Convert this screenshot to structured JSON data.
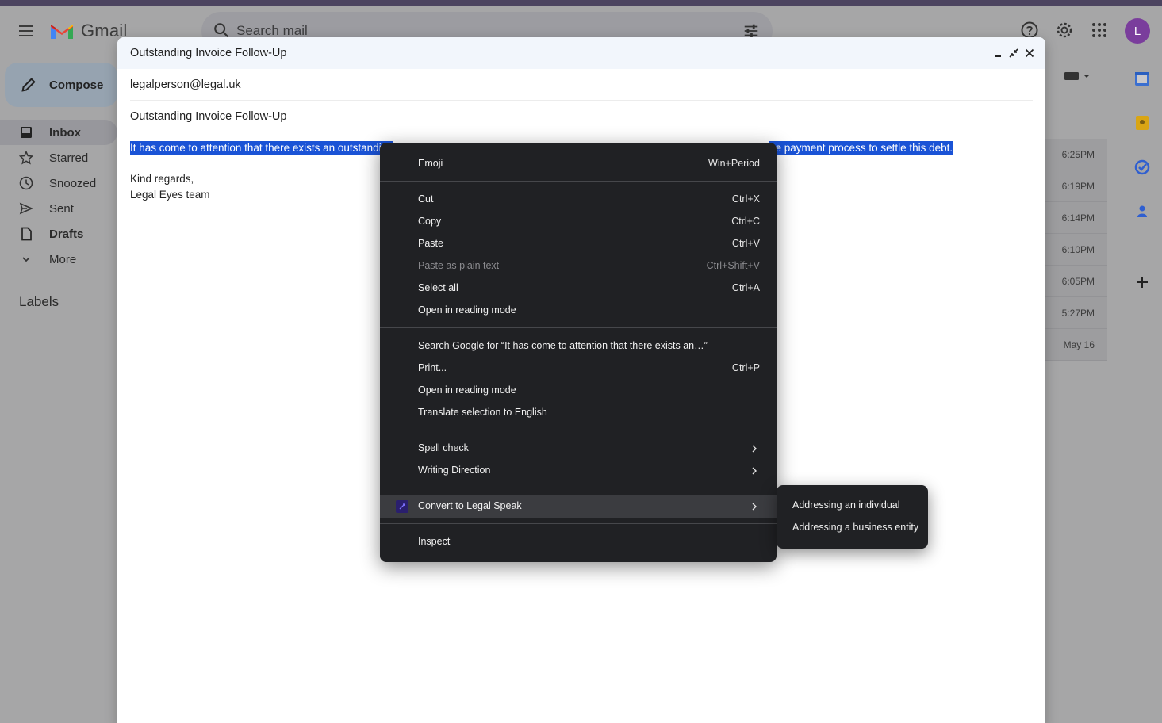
{
  "header": {
    "app_name": "Gmail",
    "search_placeholder": "Search mail",
    "avatar_letter": "L"
  },
  "nav": {
    "compose_label": "Compose",
    "items": [
      {
        "label": "Inbox",
        "icon": "inbox-icon"
      },
      {
        "label": "Starred",
        "icon": "star-icon"
      },
      {
        "label": "Snoozed",
        "icon": "clock-icon"
      },
      {
        "label": "Sent",
        "icon": "send-icon"
      },
      {
        "label": "Drafts",
        "icon": "file-icon"
      },
      {
        "label": "More",
        "icon": "chevron-down-icon"
      }
    ],
    "labels_heading": "Labels"
  },
  "inbox_times": [
    "6:25PM",
    "6:19PM",
    "6:14PM",
    "6:10PM",
    "6:05PM",
    "5:27PM",
    "May 16"
  ],
  "compose": {
    "title": "Outstanding Invoice Follow-Up",
    "to": "legalperson@legal.uk",
    "subject": "Outstanding Invoice Follow-Up",
    "body_selected_start": "It has come to attention that there exists an outstanding",
    "body_selected_end": "he payment process to settle this debt.",
    "sig_line1": "Kind regards,",
    "sig_line2": "Legal Eyes team"
  },
  "context_menu": {
    "emoji": {
      "label": "Emoji",
      "shortcut": "Win+Period"
    },
    "cut": {
      "label": "Cut",
      "shortcut": "Ctrl+X"
    },
    "copy": {
      "label": "Copy",
      "shortcut": "Ctrl+C"
    },
    "paste": {
      "label": "Paste",
      "shortcut": "Ctrl+V"
    },
    "paste_plain": {
      "label": "Paste as plain text",
      "shortcut": "Ctrl+Shift+V"
    },
    "select_all": {
      "label": "Select all",
      "shortcut": "Ctrl+A"
    },
    "reading_mode_1": {
      "label": "Open in reading mode"
    },
    "search_google": {
      "label": "Search Google for “It has come to attention that there exists an…”"
    },
    "print": {
      "label": "Print...",
      "shortcut": "Ctrl+P"
    },
    "reading_mode_2": {
      "label": "Open in reading mode"
    },
    "translate": {
      "label": "Translate selection to English"
    },
    "spell_check": {
      "label": "Spell check"
    },
    "writing_direction": {
      "label": "Writing Direction"
    },
    "legal_speak": {
      "label": "Convert to Legal Speak"
    },
    "inspect": {
      "label": "Inspect"
    }
  },
  "submenu": {
    "individual": "Addressing an individual",
    "business": "Addressing a business entity"
  }
}
